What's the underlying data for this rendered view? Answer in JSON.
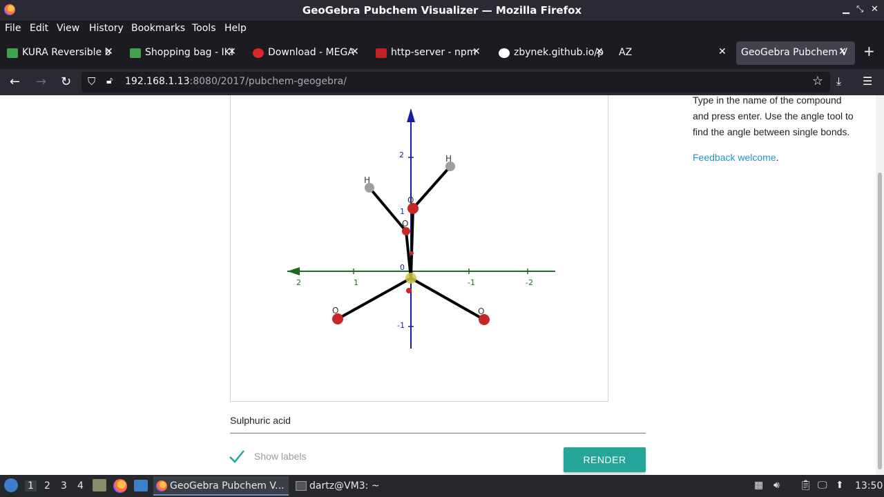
{
  "window": {
    "title": "GeoGebra Pubchem Visualizer — Mozilla Firefox"
  },
  "menu": [
    "File",
    "Edit",
    "View",
    "History",
    "Bookmarks",
    "Tools",
    "Help"
  ],
  "tabs": [
    {
      "label": "KURA Reversible b",
      "icon_color": "#3fa34d"
    },
    {
      "label": "Shopping bag - IKI",
      "icon_color": "#3fa34d"
    },
    {
      "label": "Download - MEGA",
      "icon_color": "#d9272e"
    },
    {
      "label": "http-server - npm",
      "icon_color": "#c12127"
    },
    {
      "label": "zbynek.github.io/p",
      "icon_color": "#ffffff"
    },
    {
      "label": "AZ",
      "icon_color": ""
    },
    {
      "label": "GeoGebra Pubchem V",
      "icon_color": "",
      "active": true
    }
  ],
  "address": {
    "host": "192.168.1.13",
    "rest": ":8080/2017/pubchem-geogebra/"
  },
  "sidebar": {
    "line1": "Type in the name of the compound",
    "line2": "and press enter. Use the angle tool to",
    "line3": "find the angle between single bonds.",
    "feedback_link": "Feedback welcome",
    "feedback_tail": "."
  },
  "plot": {
    "y_ticks": [
      "2",
      "1",
      "0",
      "-1"
    ],
    "x_ticks": [
      "2",
      "1",
      "-1",
      "-2"
    ],
    "atom_labels": [
      "H",
      "H",
      "O",
      "O",
      "O",
      "O"
    ]
  },
  "form": {
    "compound_value": "Sulphuric acid",
    "show_labels": "Show labels",
    "render_button": "RENDER"
  },
  "taskbar": {
    "workspaces": [
      "1",
      "2",
      "3",
      "4"
    ],
    "apps": [
      {
        "label": "GeoGebra Pubchem V...",
        "active": true
      },
      {
        "label": "dartz@VM3: ~",
        "active": false
      }
    ],
    "clock": "13:50"
  },
  "colors": {
    "accent": "#26a69a",
    "link": "#2196c3",
    "y_axis": "#1a1aa6",
    "x_axis": "#1e6b1e",
    "oxygen": "#c62828",
    "hydrogen": "#9e9e9e",
    "sulfur": "#c9c93a"
  }
}
